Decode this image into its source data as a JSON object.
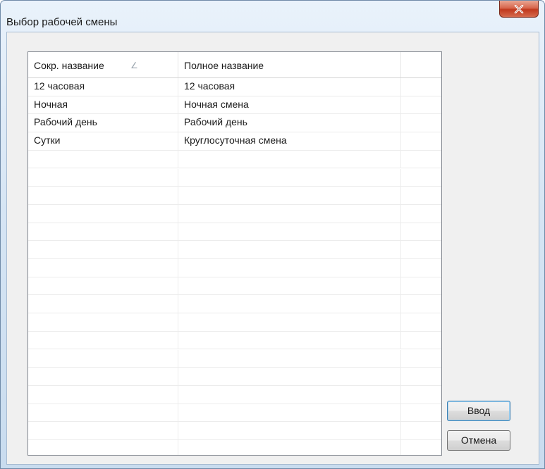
{
  "window": {
    "title": "Выбор рабочей смены",
    "close_label": "X"
  },
  "list": {
    "columns": [
      {
        "label": "Сокр. название",
        "sorted": "ascending"
      },
      {
        "label": "Полное название"
      },
      {
        "label": ""
      }
    ],
    "sort_icon": "sort-ascending-icon",
    "sort_glyph": "∠",
    "rows": [
      {
        "short": "12 часовая",
        "full": "12 часовая"
      },
      {
        "short": "Ночная",
        "full": "Ночная смена"
      },
      {
        "short": "Рабочий день",
        "full": "Рабочий день"
      },
      {
        "short": "Сутки",
        "full": "Круглосуточная смена"
      }
    ],
    "total_visible_rows": 21
  },
  "buttons": {
    "ok_label": "Ввод",
    "cancel_label": "Отмена"
  },
  "colors": {
    "close_button": "#c0391d",
    "default_button_border": "#3c7fb1",
    "grid_lines": "#ececec"
  }
}
